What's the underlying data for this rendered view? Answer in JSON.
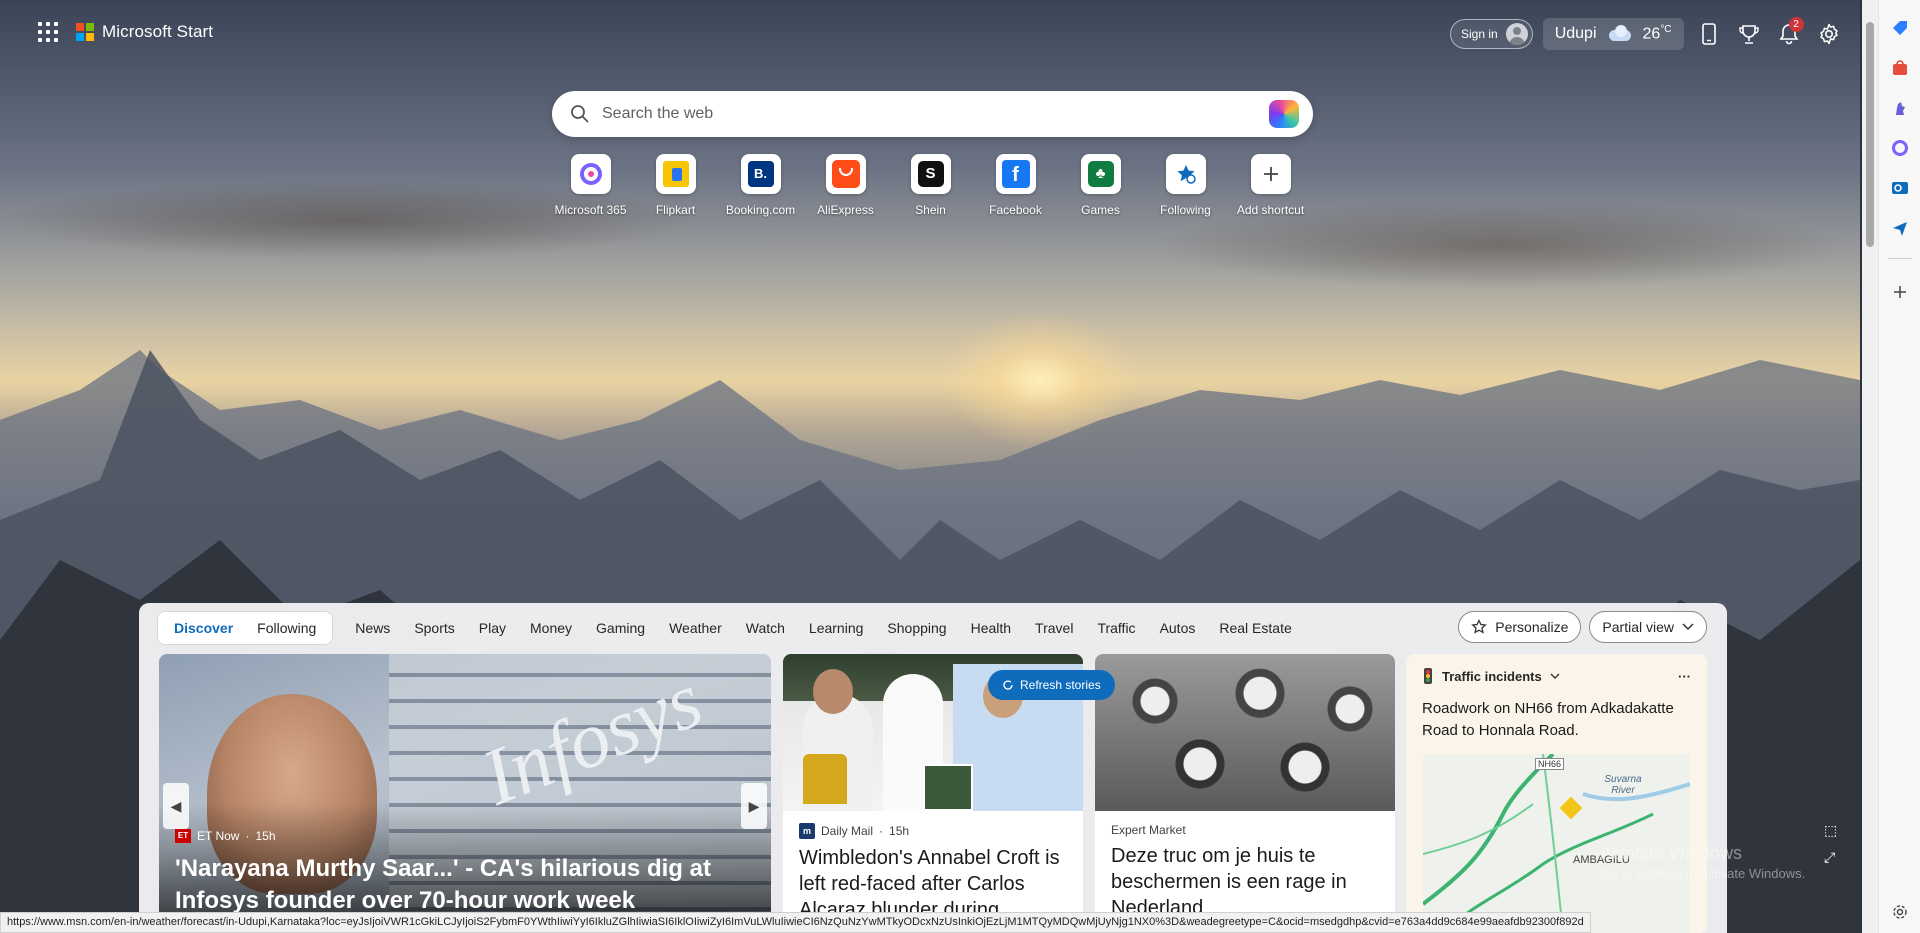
{
  "brand": {
    "name": "Microsoft Start"
  },
  "header": {
    "signin_label": "Sign in",
    "location": "Udupi",
    "temperature": "26",
    "temperature_unit": "°C",
    "notification_count": "2"
  },
  "search": {
    "placeholder": "Search the web"
  },
  "shortcuts": [
    {
      "label": "Microsoft 365",
      "icon": "microsoft365-icon",
      "color": "#7b61ff"
    },
    {
      "label": "Flipkart",
      "icon": "flipkart-icon",
      "color": "#f7c600"
    },
    {
      "label": "Booking.com",
      "icon": "booking-icon",
      "color": "#003580"
    },
    {
      "label": "AliExpress",
      "icon": "aliexpress-icon",
      "color": "#ff4d1a"
    },
    {
      "label": "Shein",
      "icon": "shein-icon",
      "color": "#111111"
    },
    {
      "label": "Facebook",
      "icon": "facebook-icon",
      "color": "#1877f2"
    },
    {
      "label": "Games",
      "icon": "games-icon",
      "color": "#107c41"
    },
    {
      "label": "Following",
      "icon": "following-icon",
      "color": "#0f6cbd"
    },
    {
      "label": "Add shortcut",
      "icon": "plus-icon",
      "color": "#444444"
    }
  ],
  "feed": {
    "tabs": {
      "discover": "Discover",
      "following": "Following"
    },
    "nav": [
      "News",
      "Sports",
      "Play",
      "Money",
      "Gaming",
      "Weather",
      "Watch",
      "Learning",
      "Shopping",
      "Health",
      "Travel",
      "Traffic",
      "Autos",
      "Real Estate"
    ],
    "personalize_label": "Personalize",
    "view_label": "Partial view",
    "refresh_label": "Refresh stories"
  },
  "hero": {
    "source": "ET Now",
    "age": "15h",
    "headline": "'Narayana Murthy Saar...' - CA's hilarious dig at Infosys founder over 70-hour work week",
    "image_text": "Infosys"
  },
  "cards": [
    {
      "source": "Daily Mail",
      "age": "15h",
      "title": "Wimbledon's Annabel Croft is left red-faced after Carlos Alcaraz blunder during"
    },
    {
      "source": "Expert Market",
      "age": "",
      "title": "Deze truc om je huis te beschermen is een rage in Nederland"
    }
  ],
  "traffic": {
    "header": "Traffic incidents",
    "description": "Roadwork on NH66 from Adkadakatte Road to Honnala Road.",
    "map_labels": {
      "road": "NH66",
      "river": "Suvarna River",
      "place": "AMBAGILU"
    }
  },
  "watermark": {
    "line1": "Activate Windows",
    "line2": "Go to Settings to activate Windows."
  },
  "status_url": "https://www.msn.com/en-in/weather/forecast/in-Udupi,Karnataka?loc=eyJsIjoiVWR1cGkiLCJyIjoiS2FybmF0YWthIiwiYyI6IkluZGlhIiwiaSI6IklOIiwiZyI6ImVuLWluIiwieCI6NzQuNzYwMTkyODcxNzUsInkiOjEzLjM1MTQyMDQwMjUyNjg1NX0%3D&weadegreetype=C&ocid=msedgdhp&cvid=e763a4dd9c684e99aeafdb92300f892d"
}
